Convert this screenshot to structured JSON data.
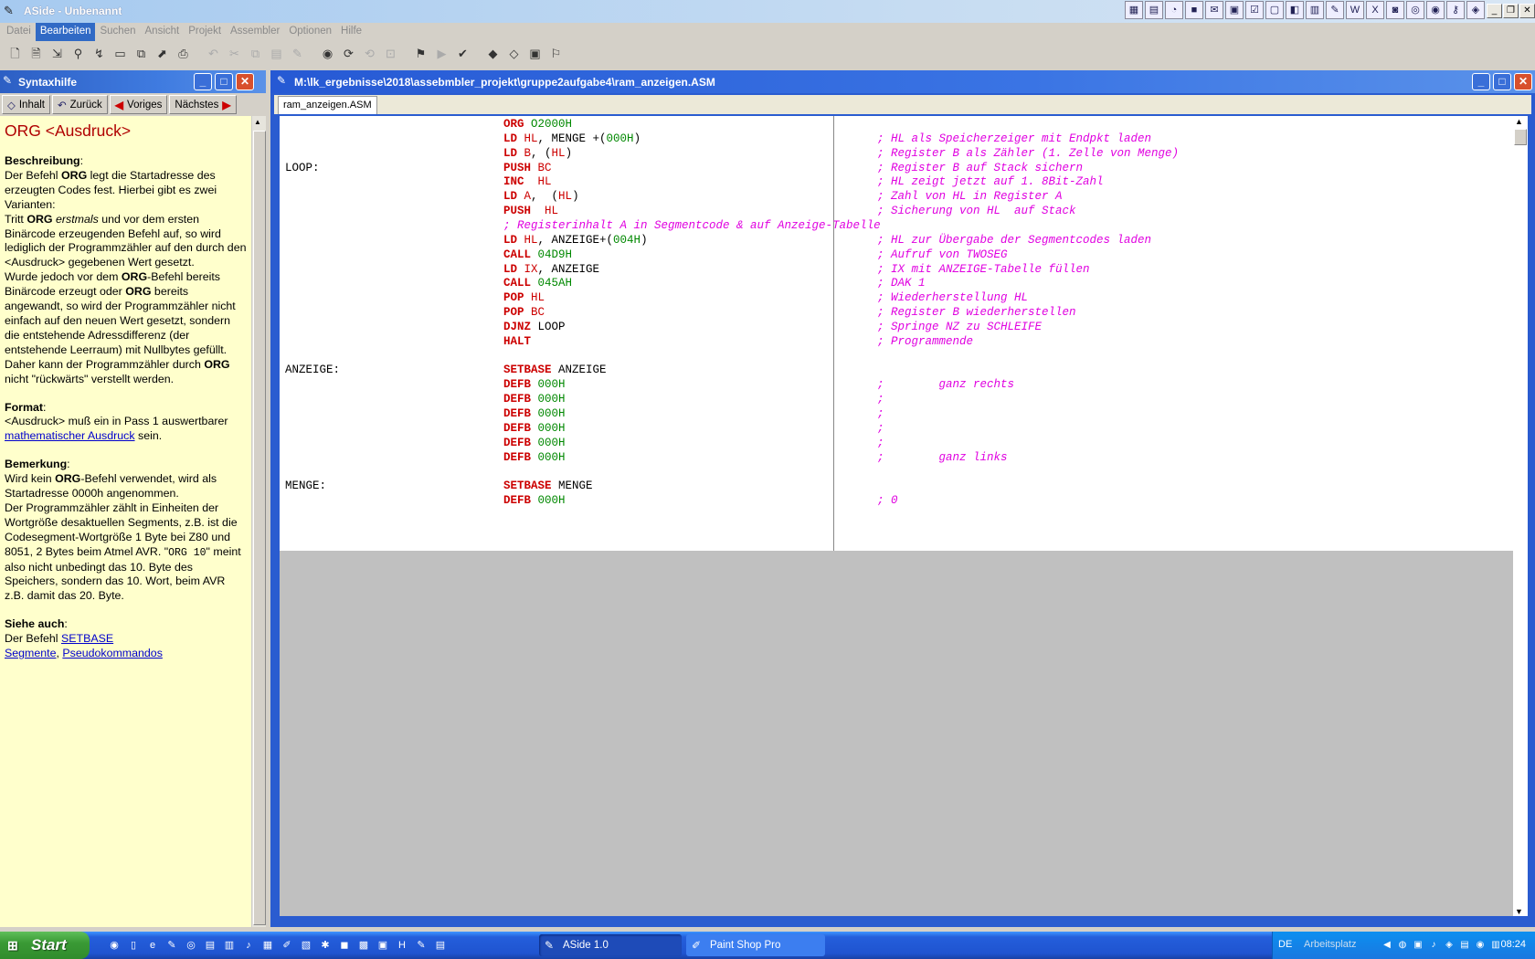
{
  "window": {
    "title": "ASide - Unbenannt"
  },
  "menu": [
    "Datei",
    "Bearbeiten",
    "Suchen",
    "Ansicht",
    "Projekt",
    "Assembler",
    "Optionen",
    "Hilfe"
  ],
  "help": {
    "title": "Syntaxhilfe",
    "nav": {
      "contents": "Inhalt",
      "back": "Zurück",
      "prev": "Voriges",
      "next": "Nächstes"
    },
    "heading": "ORG <Ausdruck>",
    "desc_label": "Beschreibung",
    "desc_1": "Der Befehl ",
    "desc_1b": "ORG",
    "desc_1c": " legt die Startadresse des erzeugten Codes fest. Hierbei gibt es zwei Varianten:",
    "desc_2a": "Tritt ",
    "desc_2b": "ORG",
    "desc_2c": " erstmals",
    "desc_2d": " und vor dem ersten Binärcode erzeugenden Befehl auf, so wird lediglich der Programmzähler auf den durch den <Ausdruck> gegebenen Wert gesetzt.",
    "desc_3a": "Wurde jedoch vor dem ",
    "desc_3b": "ORG",
    "desc_3c": "-Befehl bereits Binärcode erzeugt oder ",
    "desc_3d": "ORG",
    "desc_3e": " bereits angewandt, so wird der Programmzähler nicht einfach auf den neuen Wert gesetzt, sondern die entstehende Adressdifferenz (der entstehende Leerraum) mit Nullbytes gefüllt. Daher kann der Programmzähler durch ",
    "desc_3f": "ORG",
    "desc_3g": " nicht \"rückwärts\" verstellt werden.",
    "format_label": "Format",
    "format_text": "<Ausdruck> muß ein in Pass 1 auswertbarer ",
    "format_link": "mathematischer Ausdruck",
    "format_end": " sein.",
    "remark_label": "Bemerkung",
    "remark_1a": "Wird kein ",
    "remark_1b": "ORG",
    "remark_1c": "-Befehl verwendet, wird als Startadresse 0000h angenommen.",
    "remark_2a": "Der Programmzähler zählt in Einheiten der Wortgröße desaktuellen Segments, z.B. ist die Codesegment-Wortgröße 1 Byte bei Z80 und 8051, 2 Bytes beim Atmel AVR. \"",
    "remark_2code": "ORG 10",
    "remark_2b": "\" meint also nicht unbedingt das 10. Byte des Speichers, sondern das 10. Wort, beim AVR z.B. damit das 20. Byte.",
    "see_label": "Siehe auch",
    "see_text": "Der Befehl ",
    "see_link1": "SETBASE",
    "see_link2": "Segmente",
    "see_link3": "Pseudokommandos"
  },
  "editor": {
    "title": "M:\\lk_ergebnisse\\2018\\assebmbler_projekt\\gruppe2aufgabe4\\ram_anzeigen.ASM",
    "tab": "ram_anzeigen.ASM",
    "lines": [
      {
        "label": "",
        "op": "ORG",
        "args": [
          [
            "n",
            "O2000H"
          ]
        ],
        "comment": ""
      },
      {
        "label": "",
        "op": "LD",
        "args": [
          [
            "r",
            "HL"
          ],
          [
            "p",
            ", MENGE +("
          ],
          [
            "n",
            "000H"
          ],
          [
            "p",
            ")"
          ]
        ],
        "comment": "; HL als Speicherzeiger mit Endpkt laden"
      },
      {
        "label": "",
        "op": "LD",
        "args": [
          [
            "r",
            "B"
          ],
          [
            "p",
            ", ("
          ],
          [
            "r",
            "HL"
          ],
          [
            "p",
            ")"
          ]
        ],
        "comment": "; Register B als Zähler (1. Zelle von Menge)"
      },
      {
        "label": "LOOP:",
        "op": "PUSH",
        "args": [
          [
            "r",
            "BC"
          ]
        ],
        "comment": "; Register B auf Stack sichern"
      },
      {
        "label": "",
        "op": "INC",
        "args": [
          [
            "p",
            " "
          ],
          [
            "r",
            "HL"
          ]
        ],
        "comment": "; HL zeigt jetzt auf 1. 8Bit-Zahl"
      },
      {
        "label": "",
        "op": "LD",
        "args": [
          [
            "r",
            "A"
          ],
          [
            "p",
            ",  ("
          ],
          [
            "r",
            "HL"
          ],
          [
            "p",
            ")"
          ]
        ],
        "comment": "; Zahl von HL in Register A"
      },
      {
        "label": "",
        "op": "PUSH",
        "args": [
          [
            "p",
            " "
          ],
          [
            "r",
            "HL"
          ]
        ],
        "comment": "; Sicherung von HL  auf Stack"
      },
      {
        "label": "",
        "full": "; Registerinhalt A in Segmentcode & auf Anzeige-Tabelle"
      },
      {
        "label": "",
        "op": "LD",
        "args": [
          [
            "r",
            "HL"
          ],
          [
            "p",
            ", ANZEIGE+("
          ],
          [
            "n",
            "004H"
          ],
          [
            "p",
            ")"
          ]
        ],
        "comment": "; HL zur Übergabe der Segmentcodes laden"
      },
      {
        "label": "",
        "op": "CALL",
        "args": [
          [
            "n",
            "04D9H"
          ]
        ],
        "comment": "; Aufruf von TWOSEG"
      },
      {
        "label": "",
        "op": "LD",
        "args": [
          [
            "r",
            "IX"
          ],
          [
            "p",
            ", ANZEIGE"
          ]
        ],
        "comment": "; IX mit ANZEIGE-Tabelle füllen"
      },
      {
        "label": "",
        "op": "CALL",
        "args": [
          [
            "n",
            "045AH"
          ]
        ],
        "comment": "; DAK 1"
      },
      {
        "label": "",
        "op": "POP",
        "args": [
          [
            "r",
            "HL"
          ]
        ],
        "comment": "; Wiederherstellung HL"
      },
      {
        "label": "",
        "op": "POP",
        "args": [
          [
            "r",
            "BC"
          ]
        ],
        "comment": "; Register B wiederherstellen"
      },
      {
        "label": "",
        "op": "DJNZ",
        "args": [
          [
            "p",
            "LOOP"
          ]
        ],
        "comment": "; Springe NZ zu SCHLEIFE"
      },
      {
        "label": "",
        "op": "HALT",
        "args": [],
        "comment": "; Programmende"
      },
      {
        "label": "",
        "op": "",
        "args": [],
        "comment": ""
      },
      {
        "label": "ANZEIGE:",
        "op": "SETBASE",
        "args": [
          [
            "p",
            "ANZEIGE"
          ]
        ],
        "comment": ""
      },
      {
        "label": "",
        "op": "DEFB",
        "args": [
          [
            "n",
            "000H"
          ]
        ],
        "comment": ";        ganz rechts"
      },
      {
        "label": "",
        "op": "DEFB",
        "args": [
          [
            "n",
            "000H"
          ]
        ],
        "comment": ";"
      },
      {
        "label": "",
        "op": "DEFB",
        "args": [
          [
            "n",
            "000H"
          ]
        ],
        "comment": ";"
      },
      {
        "label": "",
        "op": "DEFB",
        "args": [
          [
            "n",
            "000H"
          ]
        ],
        "comment": ";"
      },
      {
        "label": "",
        "op": "DEFB",
        "args": [
          [
            "n",
            "000H"
          ]
        ],
        "comment": ";"
      },
      {
        "label": "",
        "op": "DEFB",
        "args": [
          [
            "n",
            "000H"
          ]
        ],
        "comment": ";        ganz links"
      },
      {
        "label": "",
        "op": "",
        "args": [],
        "comment": ""
      },
      {
        "label": "MENGE:",
        "op": "SETBASE",
        "args": [
          [
            "p",
            "MENGE"
          ]
        ],
        "comment": ""
      },
      {
        "label": "",
        "op": "DEFB",
        "args": [
          [
            "n",
            "000H"
          ]
        ],
        "comment": "; 0"
      }
    ]
  },
  "taskbar": {
    "start": "Start",
    "tasks": [
      "ASide 1.0",
      "Paint Shop Pro"
    ],
    "lang": "DE",
    "workplace": "Arbeitsplatz",
    "clock": "08:24"
  }
}
